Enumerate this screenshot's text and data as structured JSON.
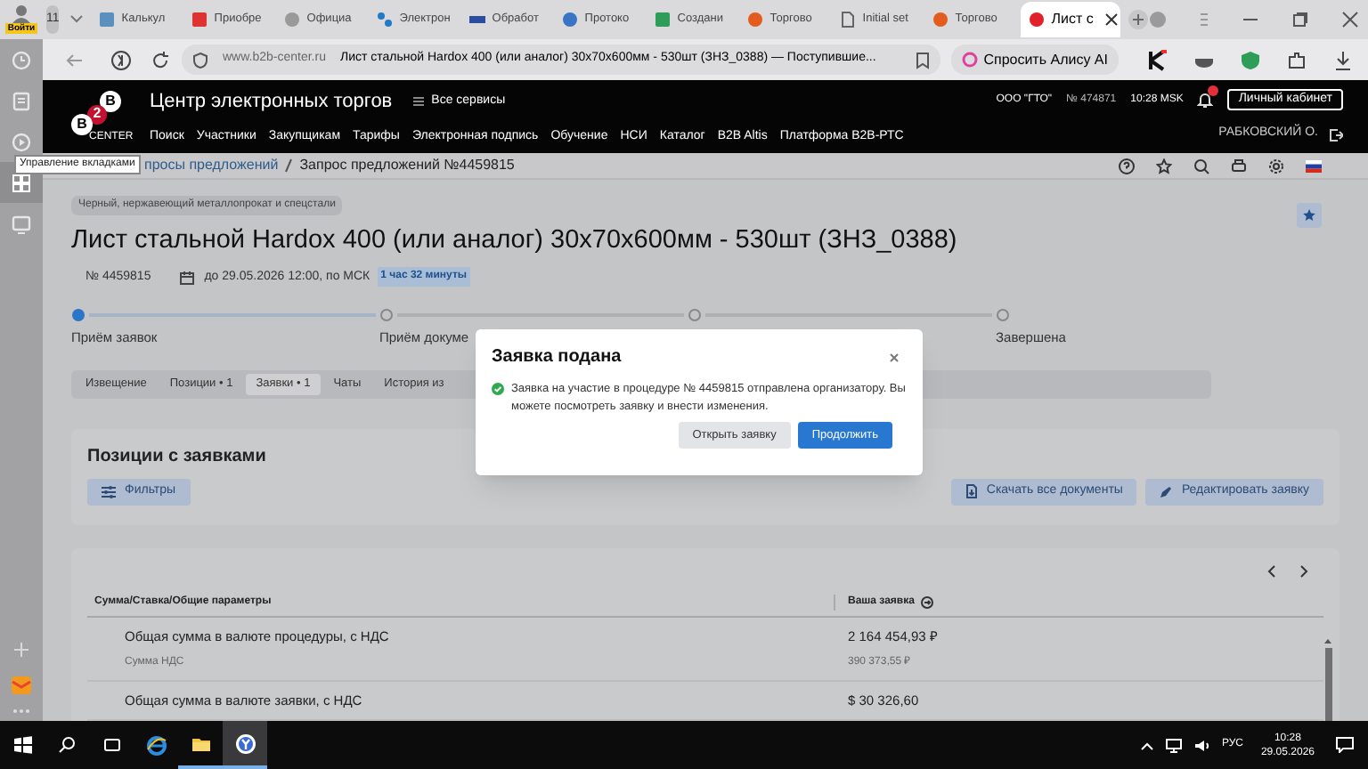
{
  "browser": {
    "profile_label": "Войти",
    "tab_count": "11",
    "tabs": [
      {
        "label": "Калькул",
        "selected": false
      },
      {
        "label": "Приобре",
        "selected": false
      },
      {
        "label": "Официа",
        "selected": false
      },
      {
        "label": "Электрон",
        "selected": false
      },
      {
        "label": "Обработ",
        "selected": false
      },
      {
        "label": "Протоко",
        "selected": false
      },
      {
        "label": "Создани",
        "selected": false
      },
      {
        "label": "Торгово",
        "selected": false
      },
      {
        "label": "Initial set",
        "selected": false
      },
      {
        "label": "Торгово",
        "selected": false
      },
      {
        "label": "Лист с",
        "selected": true
      }
    ],
    "address": {
      "domain": "www.b2b-center.ru",
      "page_title": "Лист стальной Hardox 400 (или аналог) 30x70x600мм - 530шт (ЗНЗ_0388) — Поступившие..."
    },
    "alice_button": "Спросить Алису AI",
    "tooltip": "Управление вкладками"
  },
  "header": {
    "logo": [
      "B",
      "2",
      "B",
      "CENTER"
    ],
    "title": "Центр электронных торгов",
    "services": "Все сервисы",
    "nav": [
      "Поиск",
      "Участники",
      "Закупщикам",
      "Тарифы",
      "Электронная подпись",
      "Обучение",
      "НСИ",
      "Каталог",
      "B2B Altis",
      "Платформа B2B-РТС"
    ],
    "company": "ООО \"ГТО\"",
    "account_no": "№ 474871",
    "time": "10:28 MSK",
    "cabinet": "Личный кабинет",
    "user": "РАБКОВСКИЙ О."
  },
  "breadcrumb": [
    "просы предложений",
    "Запрос предложений №4459815"
  ],
  "procedure": {
    "category": "Черный, нержавеющий металлопрокат и спецстали",
    "title": "Лист стальной Hardox 400 (или аналог) 30x70x600мм - 530шт (ЗНЗ_0388)",
    "number": "№ 4459815",
    "deadline": "до 29.05.2026 12:00, по МСК",
    "remaining": "1 час 32 минуты",
    "steps": [
      {
        "label": "Приём заявок",
        "current": true
      },
      {
        "label": "Приём докуме",
        "current": false
      },
      {
        "current": false
      },
      {
        "label": "Завершена",
        "current": false
      }
    ],
    "tabs": [
      {
        "label": "Извещение",
        "selected": false
      },
      {
        "label": "Позиции • 1",
        "selected": false
      },
      {
        "label": "Заявки • 1",
        "selected": true
      },
      {
        "label": "Чаты",
        "selected": false
      },
      {
        "label": "История из",
        "selected": false
      }
    ]
  },
  "positions": {
    "title": "Позиции с заявками",
    "filters": "Фильтры",
    "download": "Скачать все документы",
    "edit": "Редактировать заявку"
  },
  "table": {
    "columns": [
      "Сумма/Ставка/Общие параметры",
      "Ваша заявка"
    ],
    "rows": [
      {
        "label": "Общая сумма в валюте процедуры, с НДС",
        "value": "2 164 454,93 ₽",
        "sub_label": "Сумма НДС",
        "sub_value": "390 373,55 ₽"
      },
      {
        "label": "Общая сумма в валюте заявки, с НДС",
        "value": "$ 30 326,60"
      }
    ]
  },
  "modal": {
    "title": "Заявка подана",
    "message": "Заявка на участие в процедуре № 4459815 отправлена организатору. Вы можете посмотреть заявку и внести изменения.",
    "buttons": [
      {
        "label": "Открыть заявку",
        "kind": "secondary"
      },
      {
        "label": "Продолжить",
        "kind": "primary"
      }
    ]
  },
  "taskbar": {
    "language": "РУС",
    "time": "10:28",
    "date": "29.05.2026"
  }
}
